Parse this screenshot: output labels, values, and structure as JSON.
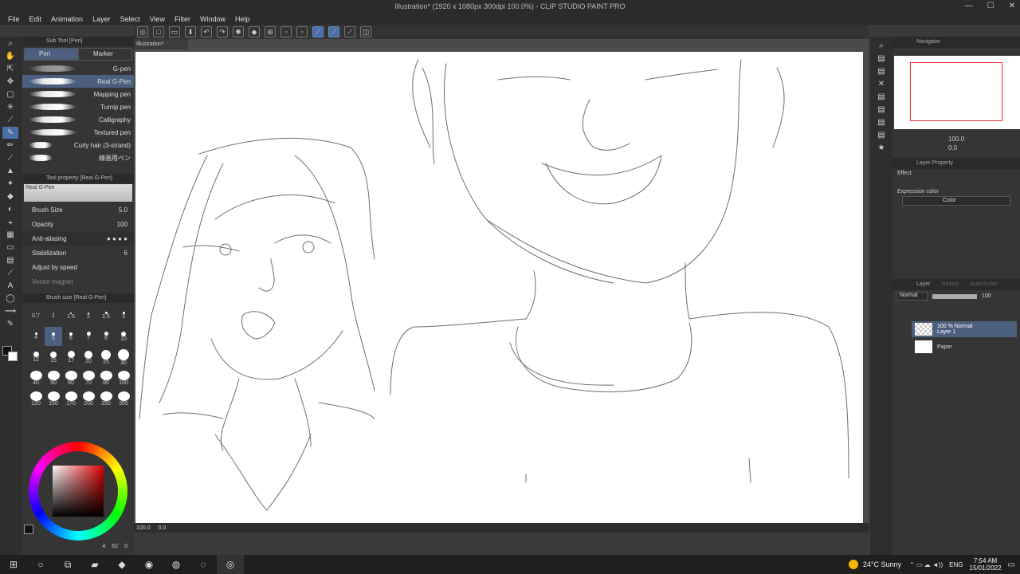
{
  "window": {
    "title": "Illustration* (1920 x 1080px 300dpi 100.0%) - CLIP STUDIO PAINT PRO"
  },
  "menu": [
    "File",
    "Edit",
    "Animation",
    "Layer",
    "Select",
    "View",
    "Filter",
    "Window",
    "Help"
  ],
  "subtool": {
    "header": "Sub Tool [Pen]",
    "tabs": [
      "Pen",
      "Marker"
    ],
    "brushes": [
      "G-pen",
      "Real G-Pen",
      "Mapping pen",
      "Turnip pen",
      "Calligraphy",
      "Textured pen",
      "Curly hair (3-strand)",
      "線画用ペン"
    ],
    "selected": "Real G-Pen"
  },
  "toolprop": {
    "header": "Tool property [Real G-Pen]",
    "preview_label": "Real G-Pen",
    "brush_size_label": "Brush Size",
    "brush_size": "5.0",
    "opacity_label": "Opacity",
    "opacity": "100",
    "antialias_label": "Anti-aliasing",
    "stabilization_label": "Stabilization",
    "stabilization": "6",
    "adjust_speed": "Adjust by speed",
    "vector_magnet": "Vector magnet"
  },
  "brushsize": {
    "header": "Brush size [Real G-Pen]",
    "values": [
      "0.7",
      "1",
      "1.5",
      "2",
      "2.5",
      "3",
      "4",
      "5",
      "6",
      "7",
      "8",
      "10",
      "12",
      "15",
      "17",
      "20",
      "25",
      "30",
      "40",
      "50",
      "60",
      "70",
      "80",
      "100",
      "120",
      "150",
      "170",
      "200",
      "250",
      "300"
    ],
    "selected": "5"
  },
  "color": {
    "bottom_values": [
      "4",
      "82",
      "0"
    ]
  },
  "canvas": {
    "tab": "Illustration*",
    "zoom": "100.0",
    "angle": "0.0"
  },
  "navigator": {
    "header": "Navigator",
    "zoom": "100.0",
    "angle": "0.0"
  },
  "layerprop": {
    "header": "Layer Property",
    "effect": "Effect",
    "expression_label": "Expression color",
    "expression_value": "Color"
  },
  "layer": {
    "header": "Layer",
    "tabs": [
      "Layer",
      "History",
      "Auto Action"
    ],
    "blend": "Normal",
    "opacity": "100",
    "layers": [
      {
        "line1": "100 % Normal",
        "line2": "Layer 1"
      },
      {
        "line1": "",
        "line2": "Paper"
      }
    ]
  },
  "taskbar": {
    "weather": "24°C  Sunny",
    "lang": "ENG",
    "time": "7:54 AM",
    "date": "15/01/2022"
  }
}
